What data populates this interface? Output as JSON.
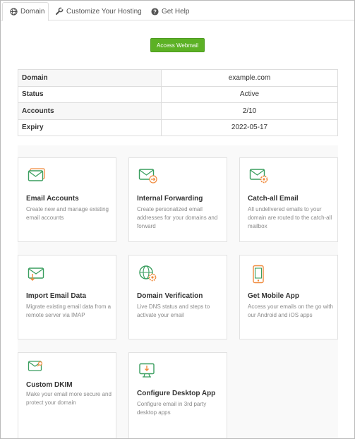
{
  "tabs": [
    {
      "label": "Domain",
      "icon": "globe-icon",
      "active": true
    },
    {
      "label": "Customize Your Hosting",
      "icon": "wrench-icon",
      "active": false
    },
    {
      "label": "Get Help",
      "icon": "question-icon",
      "active": false
    }
  ],
  "webmail_button": "Access Webmail",
  "info_table": [
    {
      "key": "Domain",
      "value": "example.com"
    },
    {
      "key": "Status",
      "value": "Active"
    },
    {
      "key": "Accounts",
      "value": "2/10"
    },
    {
      "key": "Expiry",
      "value": "2022-05-17"
    }
  ],
  "cards": [
    {
      "title": "Email Accounts",
      "desc": "Create new and manage existing email accounts",
      "icon": "envelope-icon"
    },
    {
      "title": "Internal Forwarding",
      "desc": "Create personalized email addresses for your domains and forward",
      "icon": "envelope-forward-icon"
    },
    {
      "title": "Catch-all Email",
      "desc": "All undelivered emails to your domain are routed to the catch-all mailbox",
      "icon": "envelope-gear-icon"
    },
    {
      "title": "Import Email Data",
      "desc": "Migrate existing email data from a remote server via IMAP",
      "icon": "envelope-import-icon"
    },
    {
      "title": "Domain Verification",
      "desc": "Live DNS status and steps to activate your email",
      "icon": "globe-gear-icon"
    },
    {
      "title": "Get Mobile App",
      "desc": "Access your emails on the go with our Android and iOS apps",
      "icon": "mobile-phone-icon"
    },
    {
      "title": "Custom DKIM",
      "desc": "Make your email more secure and protect your domain",
      "icon": "envelope-key-icon"
    },
    {
      "title": "Configure Desktop App",
      "desc": "Configure email in 3rd party desktop apps",
      "icon": "desktop-monitor-icon"
    }
  ],
  "colors": {
    "accent_orange": "#f08a3c",
    "accent_green": "#3a9e5f",
    "button_green": "#5cb125"
  }
}
